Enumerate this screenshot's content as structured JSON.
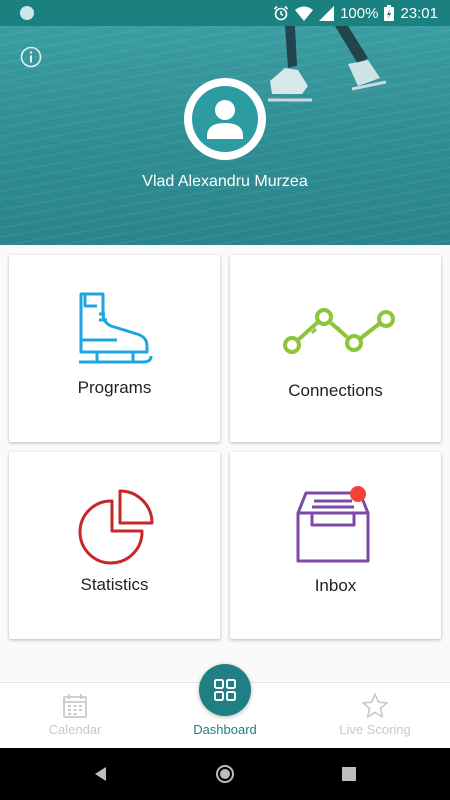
{
  "status_bar": {
    "battery": "100%",
    "time": "23:01"
  },
  "profile": {
    "name": "Vlad Alexandru Murzea"
  },
  "tiles": {
    "programs": "Programs",
    "connections": "Connections",
    "statistics": "Statistics",
    "inbox": "Inbox"
  },
  "bottom_nav": {
    "calendar": "Calendar",
    "dashboard": "Dashboard",
    "live_scoring": "Live Scoring"
  },
  "colors": {
    "teal": "#1f7f82",
    "programs_icon": "#1fa6e0",
    "connections_icon": "#8cc43a",
    "statistics_icon": "#c62828",
    "inbox_icon": "#7b4aa6",
    "badge": "#f44336"
  },
  "icons": {
    "status_left": "app-notification-icon",
    "alarm": "alarm-icon",
    "wifi": "wifi-icon",
    "signal": "signal-icon",
    "battery": "battery-icon"
  }
}
